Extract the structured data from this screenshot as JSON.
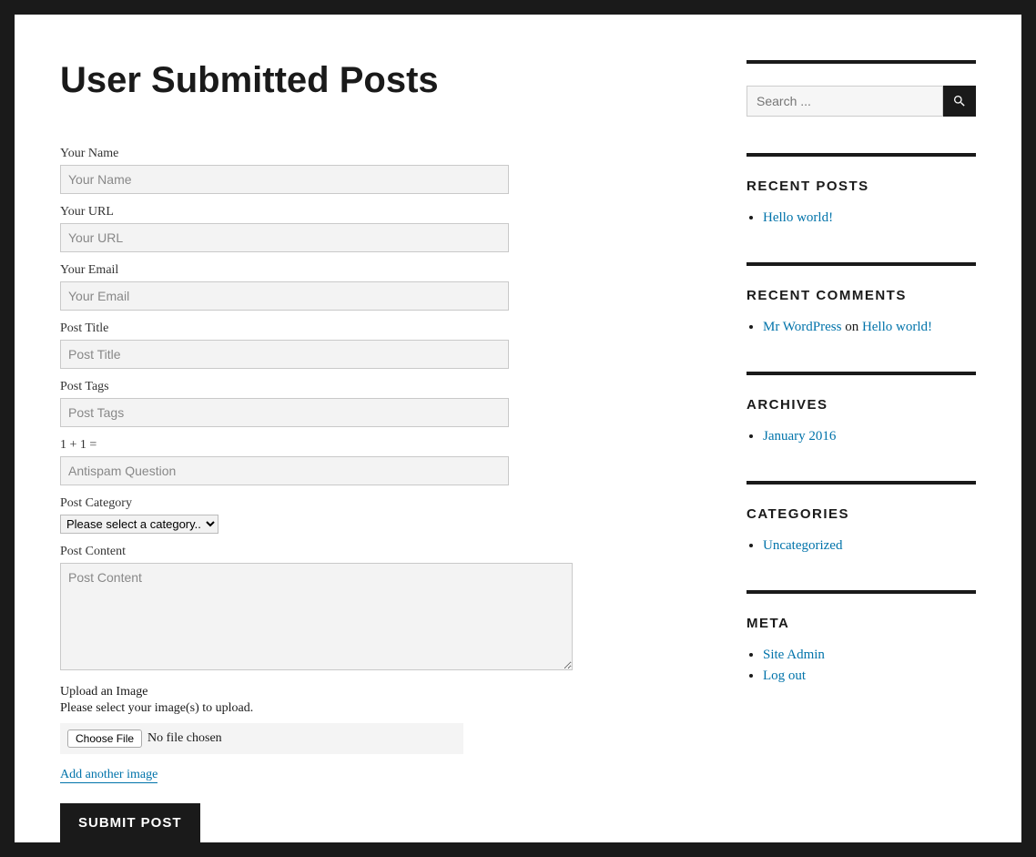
{
  "page": {
    "title": "User Submitted Posts"
  },
  "form": {
    "name": {
      "label": "Your Name",
      "placeholder": "Your Name"
    },
    "url": {
      "label": "Your URL",
      "placeholder": "Your URL"
    },
    "email": {
      "label": "Your Email",
      "placeholder": "Your Email"
    },
    "post_title": {
      "label": "Post Title",
      "placeholder": "Post Title"
    },
    "post_tags": {
      "label": "Post Tags",
      "placeholder": "Post Tags"
    },
    "antispam": {
      "label": "1 + 1 =",
      "placeholder": "Antispam Question"
    },
    "category": {
      "label": "Post Category",
      "selected": "Please select a category.."
    },
    "content": {
      "label": "Post Content",
      "placeholder": "Post Content"
    },
    "upload": {
      "label": "Upload an Image",
      "description": "Please select your image(s) to upload.",
      "button": "Choose File",
      "status": "No file chosen",
      "add_link": "Add another image"
    },
    "submit": "SUBMIT POST"
  },
  "sidebar": {
    "search": {
      "placeholder": "Search ..."
    },
    "recent_posts": {
      "heading": "RECENT POSTS",
      "items": [
        "Hello world!"
      ]
    },
    "recent_comments": {
      "heading": "RECENT COMMENTS",
      "items": [
        {
          "author": "Mr WordPress",
          "sep": " on ",
          "post": "Hello world!"
        }
      ]
    },
    "archives": {
      "heading": "ARCHIVES",
      "items": [
        "January 2016"
      ]
    },
    "categories": {
      "heading": "CATEGORIES",
      "items": [
        "Uncategorized"
      ]
    },
    "meta": {
      "heading": "META",
      "items": [
        "Site Admin",
        "Log out"
      ]
    }
  }
}
